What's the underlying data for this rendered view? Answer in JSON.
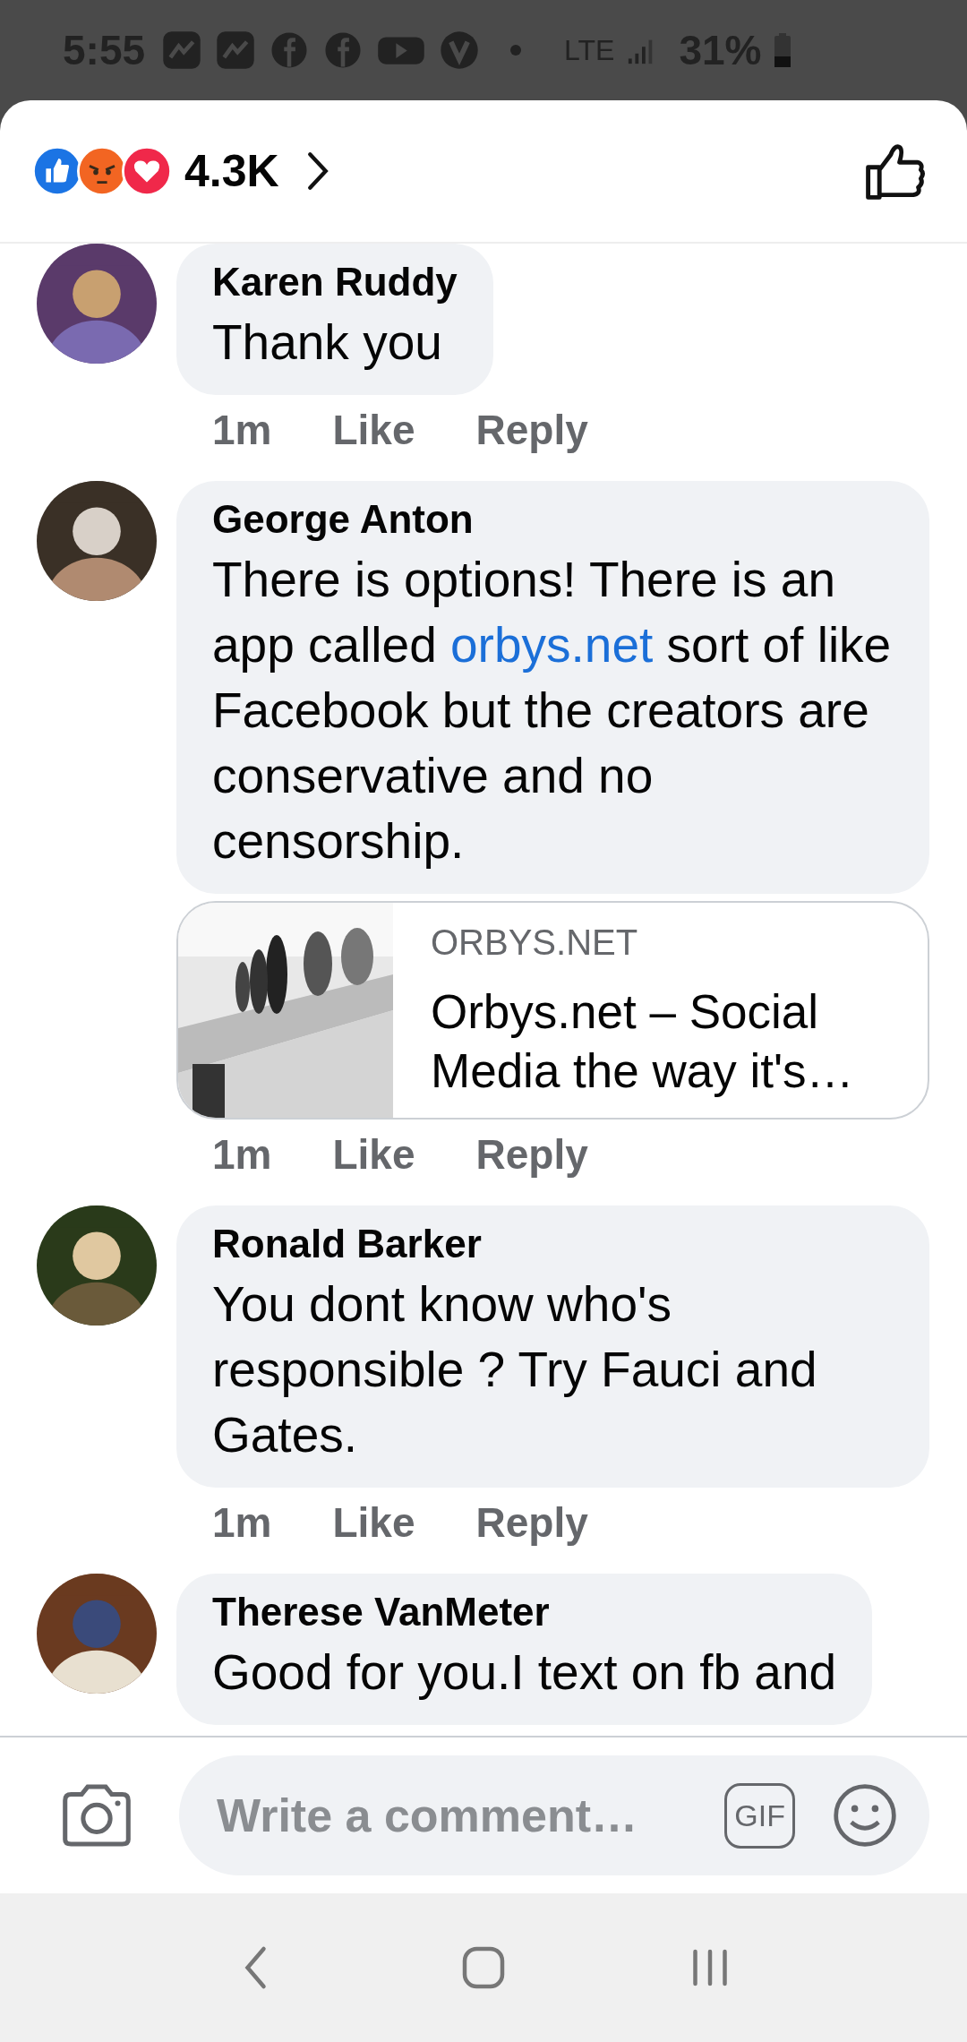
{
  "status_bar": {
    "time": "5:55",
    "network": "LTE",
    "battery": "31%"
  },
  "header": {
    "reaction_count": "4.3K"
  },
  "comments": [
    {
      "author": "Karen Ruddy",
      "segments": [
        {
          "text": "Thank you"
        }
      ],
      "time": "1m",
      "like": "Like",
      "reply": "Reply",
      "avatar": {
        "kind": "picture"
      }
    },
    {
      "author": "George Anton",
      "segments": [
        {
          "text": "There is options! There is an app called "
        },
        {
          "text": "orbys.net",
          "kind": "link"
        },
        {
          "text": " sort of like Facebook but the creators are conservative and no censorship."
        }
      ],
      "link_preview": {
        "domain": "ORBYS.NET",
        "title": "Orbys.net – Social Media the way it's…",
        "image": {
          "kind": "picture"
        }
      },
      "time": "1m",
      "like": "Like",
      "reply": "Reply",
      "avatar": {
        "kind": "picture"
      }
    },
    {
      "author": "Ronald Barker",
      "segments": [
        {
          "text": "You dont know who's responsible ? Try Fauci and Gates."
        }
      ],
      "time": "1m",
      "like": "Like",
      "reply": "Reply",
      "avatar": {
        "kind": "picture"
      }
    },
    {
      "author": "Therese VanMeter",
      "segments": [
        {
          "text": "Good for you.I text on fb and"
        }
      ],
      "avatar": {
        "kind": "picture"
      }
    }
  ],
  "composer": {
    "placeholder": "Write a comment…",
    "gif_label": "GIF"
  }
}
